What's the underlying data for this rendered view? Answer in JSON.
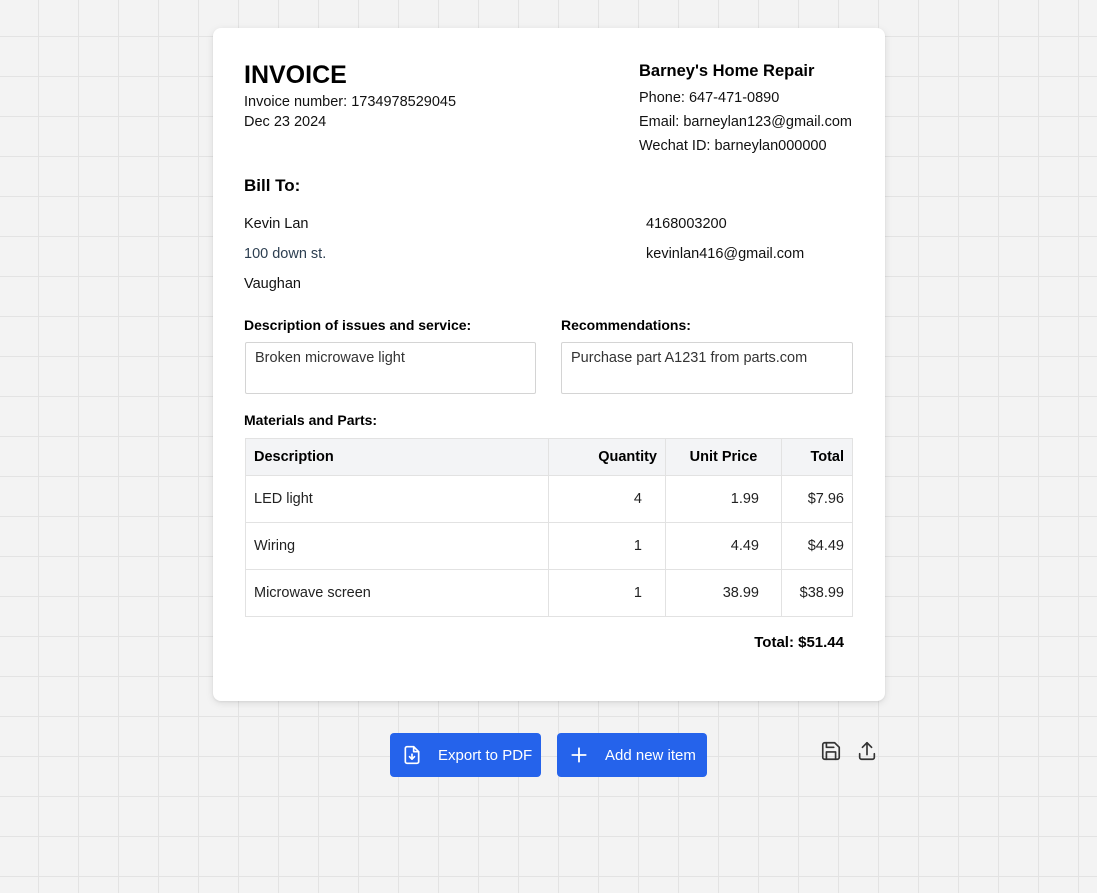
{
  "invoice": {
    "title": "INVOICE",
    "number_line": "Invoice number: 1734978529045",
    "date": "Dec 23 2024"
  },
  "business": {
    "name": "Barney's Home Repair",
    "phone": "Phone: 647-471-0890",
    "email": "Email: barneylan123@gmail.com",
    "wechat": "Wechat ID: barneylan000000"
  },
  "bill_to": {
    "label": "Bill To:",
    "name": "Kevin Lan",
    "address": "100 down st.",
    "city": "Vaughan",
    "phone": "4168003200",
    "email": "kevinlan416@gmail.com"
  },
  "description": {
    "label": "Description of issues and service:",
    "value": "Broken microwave light"
  },
  "recommendations": {
    "label": "Recommendations:",
    "value": "Purchase part A1231 from parts.com"
  },
  "materials": {
    "label": "Materials and Parts:",
    "headers": {
      "description": "Description",
      "quantity": "Quantity",
      "unit_price": "Unit Price",
      "total": "Total"
    },
    "rows": [
      {
        "description": "LED light",
        "quantity": "4",
        "unit_price": "1.99",
        "total": "$7.96"
      },
      {
        "description": "Wiring",
        "quantity": "1",
        "unit_price": "4.49",
        "total": "$4.49"
      },
      {
        "description": "Microwave screen",
        "quantity": "1",
        "unit_price": "38.99",
        "total": "$38.99"
      }
    ]
  },
  "grand_total": "Total: $51.44",
  "actions": {
    "export_label": "Export to PDF",
    "add_label": "Add new item"
  },
  "icons": {
    "export": "file-download-icon",
    "add": "plus-icon",
    "save": "save-icon",
    "upload": "upload-icon"
  },
  "colors": {
    "primary": "#2563eb",
    "background": "#f3f3f3",
    "card": "#ffffff"
  }
}
